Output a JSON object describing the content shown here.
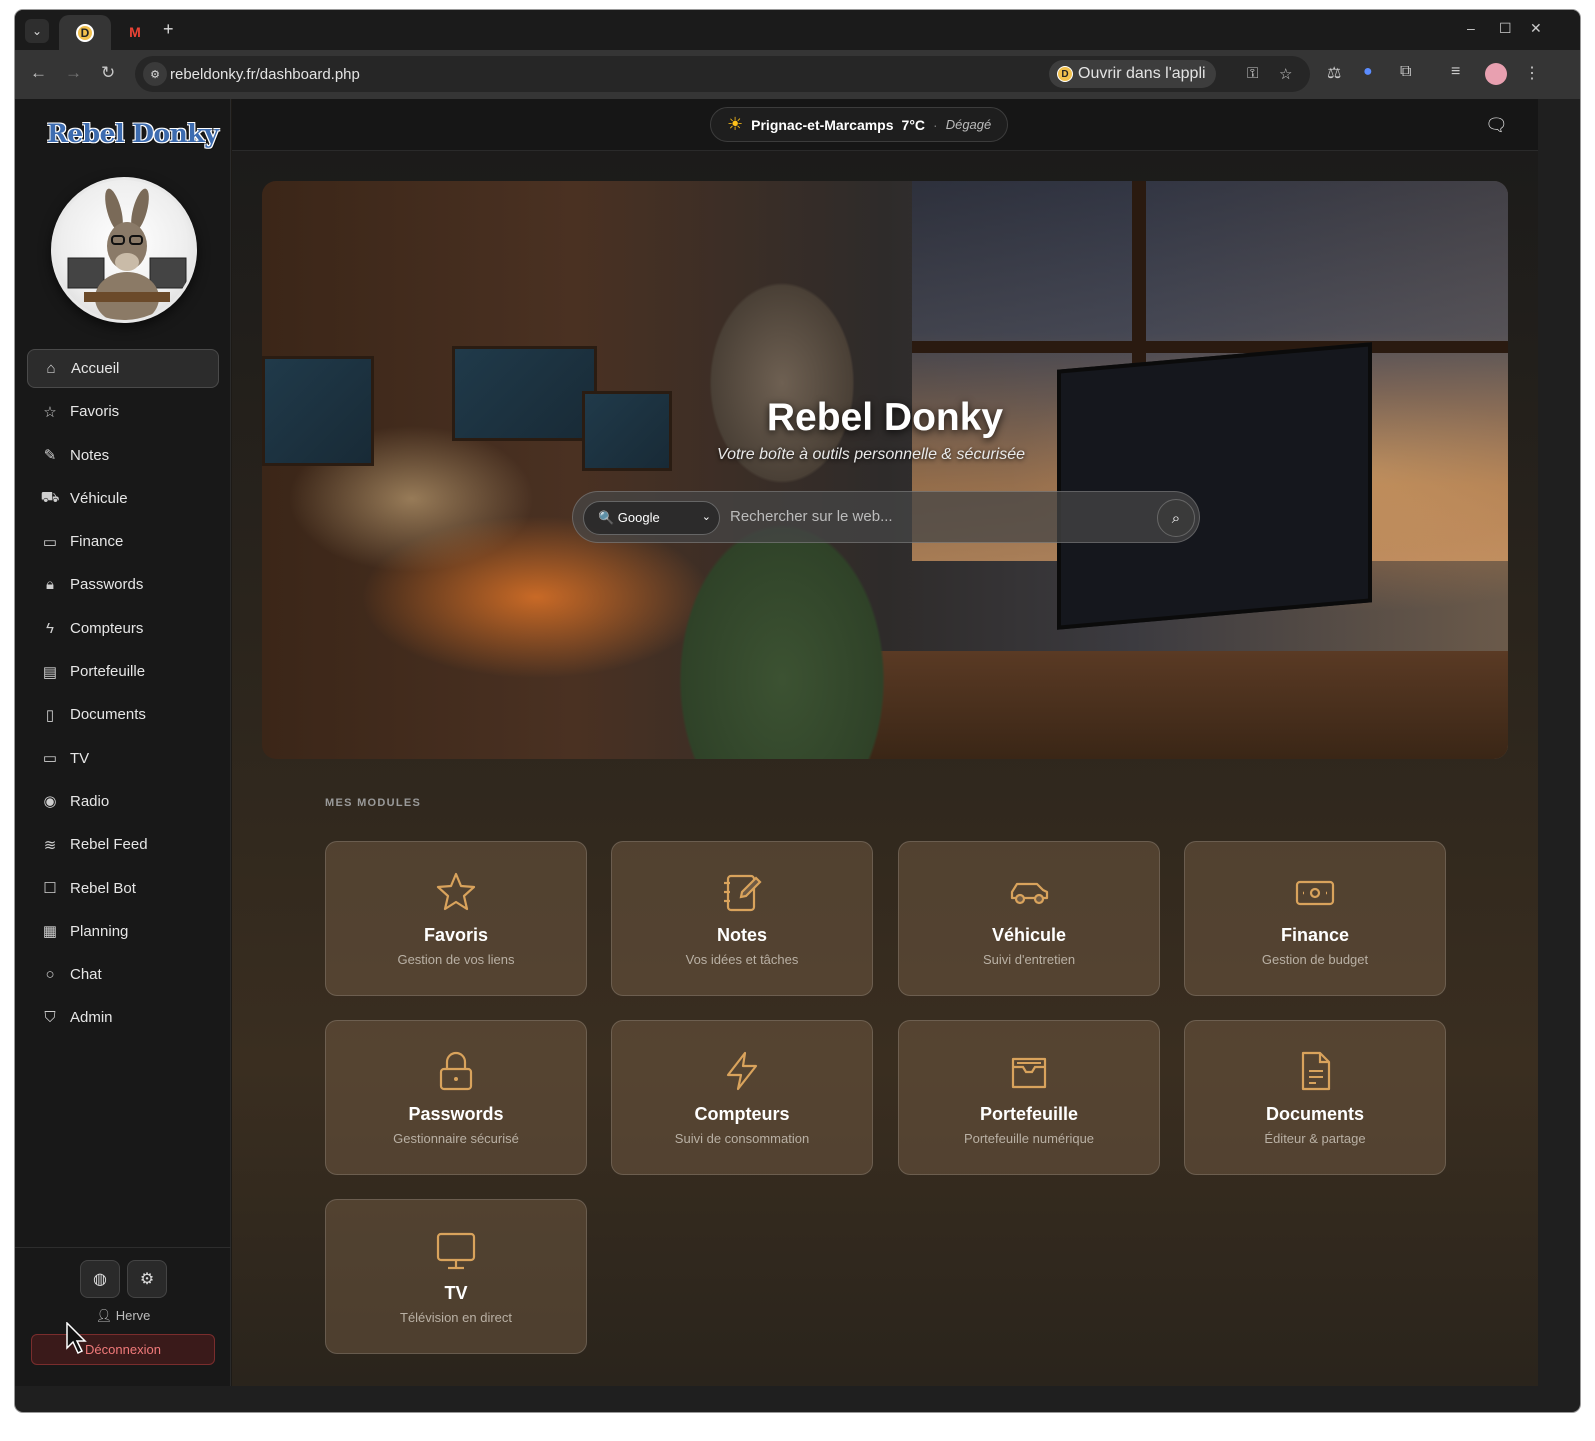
{
  "browser": {
    "url": "rebeldonky.fr/dashboard.php",
    "open_app_label": "Ouvrir dans l'appli",
    "active_tab_favicon_letter": "D",
    "gmail_tab_letter": "M",
    "new_tab_symbol": "+"
  },
  "sidebar": {
    "logo_text": "Rebel Donky",
    "items": [
      {
        "label": "Accueil",
        "icon": "home-icon",
        "glyph": "⌂"
      },
      {
        "label": "Favoris",
        "icon": "star-icon",
        "glyph": "☆"
      },
      {
        "label": "Notes",
        "icon": "notebook-pen-icon",
        "glyph": "✎"
      },
      {
        "label": "Véhicule",
        "icon": "car-icon",
        "glyph": "⛟"
      },
      {
        "label": "Finance",
        "icon": "banknote-icon",
        "glyph": "▭"
      },
      {
        "label": "Passwords",
        "icon": "lock-icon",
        "glyph": "🔒︎"
      },
      {
        "label": "Compteurs",
        "icon": "zap-icon",
        "glyph": "ϟ"
      },
      {
        "label": "Portefeuille",
        "icon": "wallet-icon",
        "glyph": "▤"
      },
      {
        "label": "Documents",
        "icon": "file-text-icon",
        "glyph": "▯"
      },
      {
        "label": "TV",
        "icon": "monitor-icon",
        "glyph": "▭"
      },
      {
        "label": "Radio",
        "icon": "radio-icon",
        "glyph": "◉"
      },
      {
        "label": "Rebel Feed",
        "icon": "rss-icon",
        "glyph": "≋"
      },
      {
        "label": "Rebel Bot",
        "icon": "bot-icon",
        "glyph": "☐"
      },
      {
        "label": "Planning",
        "icon": "calendar-layout-icon",
        "glyph": "▦"
      },
      {
        "label": "Chat",
        "icon": "message-circle-icon",
        "glyph": "○"
      },
      {
        "label": "Admin",
        "icon": "shield-check-icon",
        "glyph": "⛉"
      }
    ],
    "user_name": "Herve",
    "logout_label": "Déconnexion"
  },
  "weather": {
    "city": "Prignac-et-Marcamps",
    "temp": "7°C",
    "condition": "Dégagé",
    "separator": "·"
  },
  "hero": {
    "title": "Rebel Donky",
    "subtitle": "Votre boîte à outils personnelle & sécurisée",
    "search_engine": "🔍 Google",
    "search_placeholder": "Rechercher sur le web..."
  },
  "modules_title": "MES MODULES",
  "modules": [
    {
      "title": "Favoris",
      "subtitle": "Gestion de vos liens",
      "icon": "star-icon"
    },
    {
      "title": "Notes",
      "subtitle": "Vos idées et tâches",
      "icon": "notebook-pen-icon"
    },
    {
      "title": "Véhicule",
      "subtitle": "Suivi d'entretien",
      "icon": "car-icon"
    },
    {
      "title": "Finance",
      "subtitle": "Gestion de budget",
      "icon": "banknote-icon"
    },
    {
      "title": "Passwords",
      "subtitle": "Gestionnaire sécurisé",
      "icon": "lock-icon"
    },
    {
      "title": "Compteurs",
      "subtitle": "Suivi de consommation",
      "icon": "zap-icon"
    },
    {
      "title": "Portefeuille",
      "subtitle": "Portefeuille numérique",
      "icon": "wallet-icon"
    },
    {
      "title": "Documents",
      "subtitle": "Éditeur & partage",
      "icon": "file-text-icon"
    },
    {
      "title": "TV",
      "subtitle": "Télévision en direct",
      "icon": "monitor-icon"
    }
  ],
  "colors": {
    "accent": "#d9a35c",
    "logout": "#f07a7a",
    "sun": "#ffc21a"
  }
}
